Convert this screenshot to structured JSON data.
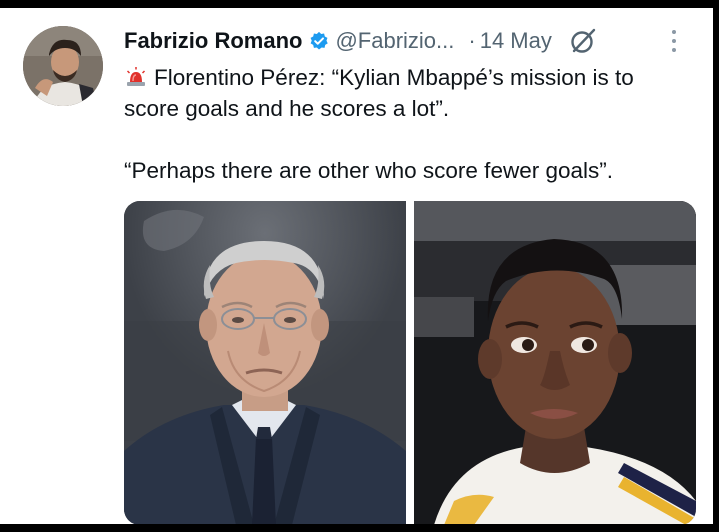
{
  "tweet": {
    "author_name": "Fabrizio Romano",
    "author_handle": "@Fabrizio...",
    "separator": "·",
    "date": "14 May",
    "line1": "Florentino Pérez: “Kylian Mbappé’s mission is to score goals and he scores a lot”.",
    "line2": "“Perhaps there are other who score fewer goals”."
  },
  "icons": {
    "verified": "verified-badge-icon",
    "grok": "grok-icon",
    "more": "more-options-icon",
    "siren": "rotating-light-emoji"
  },
  "colors": {
    "text_primary": "#0f1419",
    "text_secondary": "#536471",
    "verified_blue": "#1d9bf0",
    "siren_red": "#e0312b"
  }
}
